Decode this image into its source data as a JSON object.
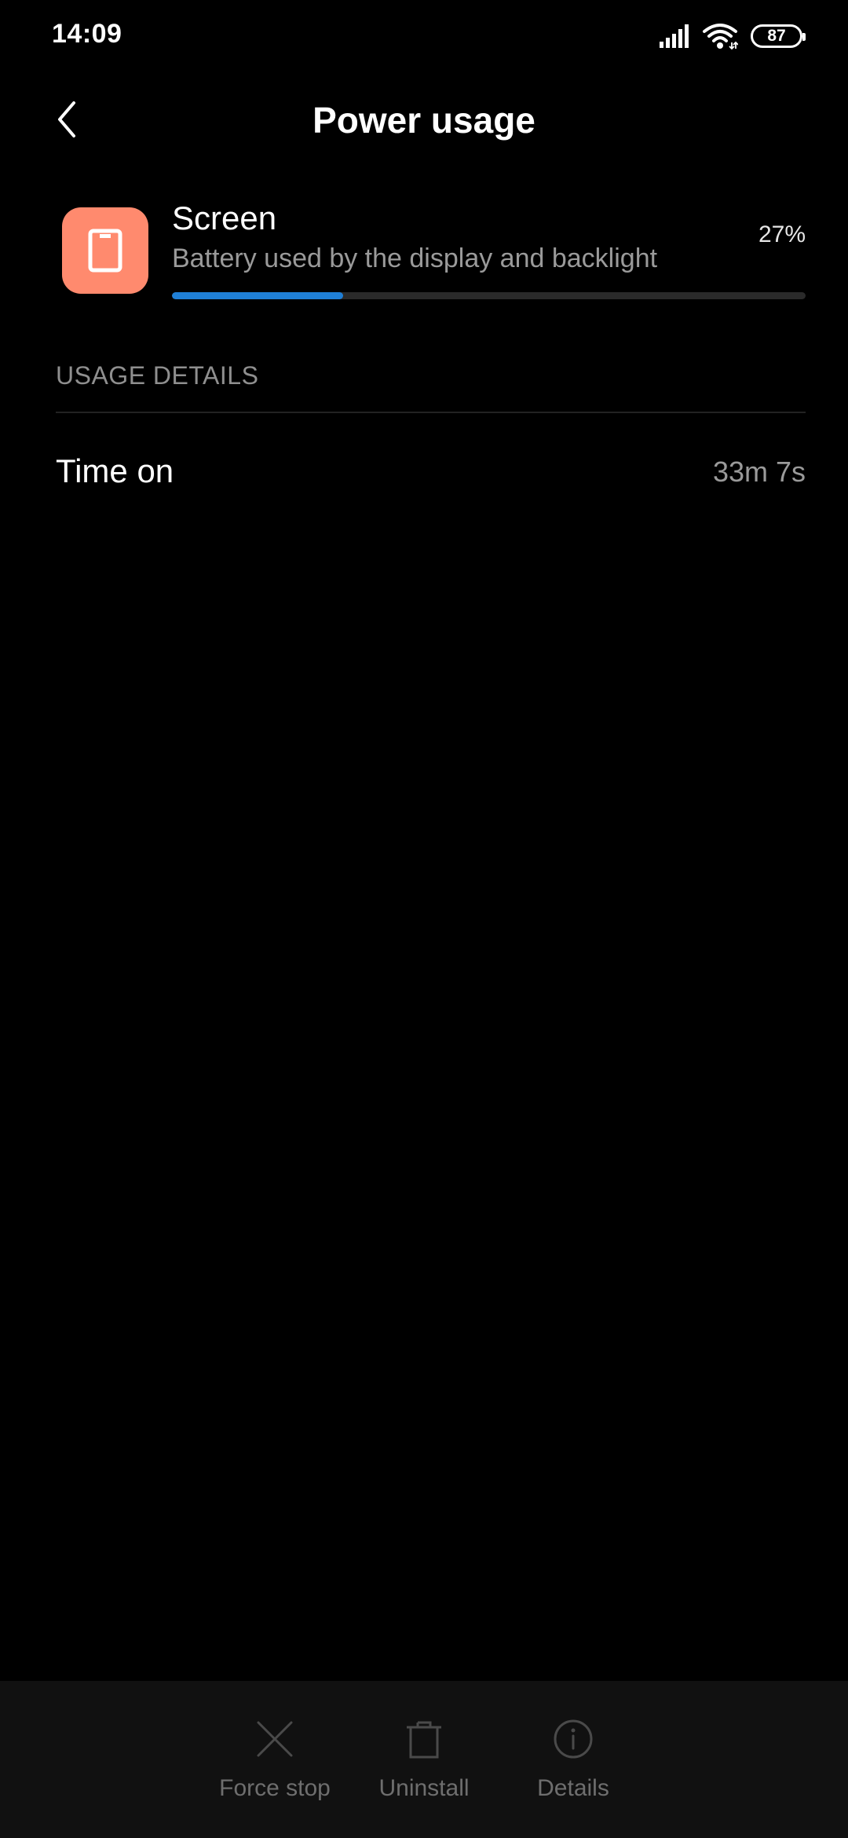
{
  "status_bar": {
    "time": "14:09",
    "battery_level": "87",
    "icons": [
      "signal-icon",
      "wifi-icon",
      "battery-icon"
    ]
  },
  "header": {
    "title": "Power usage",
    "back_icon": "chevron-left-icon"
  },
  "app": {
    "name": "Screen",
    "description": "Battery used by the display and backlight",
    "percent": "27%",
    "usage_fraction": 0.27,
    "icon": "tablet-icon",
    "icon_color": "#ff8a6e",
    "progress_color": "#1f7fd6"
  },
  "usage_details": {
    "section_title": "USAGE DETAILS",
    "rows": [
      {
        "label": "Time on",
        "value": "33m 7s"
      }
    ]
  },
  "bottom_actions": [
    {
      "label": "Force stop",
      "icon": "close-icon"
    },
    {
      "label": "Uninstall",
      "icon": "trash-icon"
    },
    {
      "label": "Details",
      "icon": "info-icon"
    }
  ]
}
